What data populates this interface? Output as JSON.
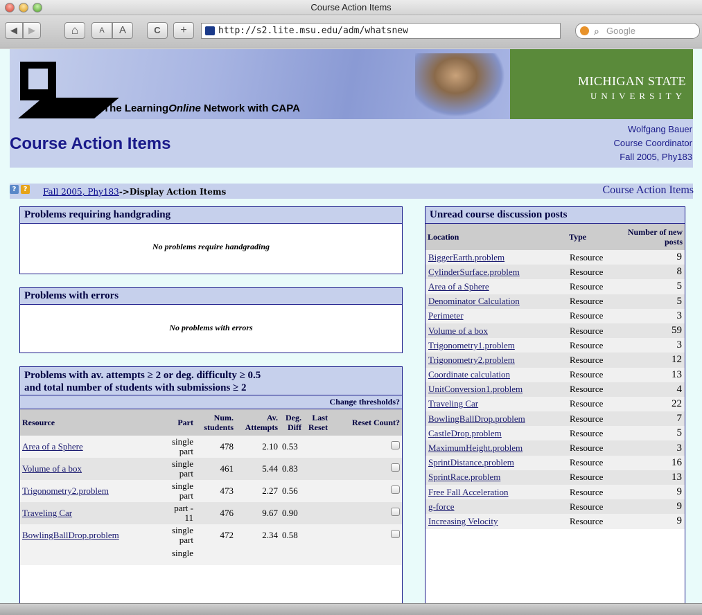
{
  "window": {
    "title": "Course Action Items"
  },
  "toolbar": {
    "back": "◀",
    "forward": "▶",
    "home": "⌂",
    "text_smaller": "A",
    "text_bigger": "A",
    "reload": "C",
    "add": "+",
    "url": "http://s2.lite.msu.edu/adm/whatsnew",
    "search_placeholder": "Google"
  },
  "banner": {
    "network_prefix": "The Learning",
    "network_italic": "Online",
    "network_suffix": " Network with CAPA",
    "msu_line1": "MICHIGAN STATE",
    "msu_line2": "UNIVERSITY"
  },
  "header": {
    "page_title": "Course Action Items",
    "user_name": "Wolfgang Bauer",
    "user_role": "Course Coordinator",
    "course": "Fall 2005, Phy183"
  },
  "nav": {
    "help_left": "?",
    "help_right": "?",
    "breadcrumb_link": "Fall 2005, Phy183",
    "breadcrumb_current": "->Display Action Items",
    "right_title": "Course Action Items"
  },
  "handgrading": {
    "title": "Problems requiring handgrading",
    "message": "No problems require handgrading"
  },
  "errors": {
    "title": "Problems with errors",
    "message": "No problems with errors"
  },
  "difficulty": {
    "title_line1": "Problems with av. attempts ≥ 2 or deg. difficulty ≥ 0.5",
    "title_line2": "and total number of students with submissions ≥ 2",
    "change_link": "Change thresholds?",
    "columns": [
      "Resource",
      "Part",
      "Num. students",
      "Av. Attempts",
      "Deg. Diff",
      "Last Reset",
      "Reset Count?"
    ],
    "rows": [
      {
        "resource": "Area of a Sphere",
        "part": "single part",
        "students": "478",
        "attempts": "2.10",
        "diff": "0.53",
        "last_reset": ""
      },
      {
        "resource": "Volume of a box",
        "part": "single part",
        "students": "461",
        "attempts": "5.44",
        "diff": "0.83",
        "last_reset": ""
      },
      {
        "resource": "Trigonometry2.problem",
        "part": "single part",
        "students": "473",
        "attempts": "2.27",
        "diff": "0.56",
        "last_reset": ""
      },
      {
        "resource": "Traveling Car",
        "part": "part - 11",
        "students": "476",
        "attempts": "9.67",
        "diff": "0.90",
        "last_reset": ""
      },
      {
        "resource": "BowlingBallDrop.problem",
        "part": "single part",
        "students": "472",
        "attempts": "2.34",
        "diff": "0.58",
        "last_reset": ""
      }
    ],
    "partial_row_part": "single"
  },
  "discussion": {
    "title": "Unread course discussion posts",
    "columns": [
      "Location",
      "Type",
      "Number of new posts"
    ],
    "rows": [
      {
        "location": "BiggerEarth.problem",
        "type": "Resource",
        "count": "9"
      },
      {
        "location": "CylinderSurface.problem",
        "type": "Resource",
        "count": "8"
      },
      {
        "location": "Area of a Sphere",
        "type": "Resource",
        "count": "5"
      },
      {
        "location": "Denominator Calculation",
        "type": "Resource",
        "count": "5"
      },
      {
        "location": "Perimeter",
        "type": "Resource",
        "count": "3"
      },
      {
        "location": "Volume of a box",
        "type": "Resource",
        "count": "59"
      },
      {
        "location": "Trigonometry1.problem",
        "type": "Resource",
        "count": "3"
      },
      {
        "location": "Trigonometry2.problem",
        "type": "Resource",
        "count": "12"
      },
      {
        "location": "Coordinate calculation",
        "type": "Resource",
        "count": "13"
      },
      {
        "location": "UnitConversion1.problem",
        "type": "Resource",
        "count": "4"
      },
      {
        "location": "Traveling Car",
        "type": "Resource",
        "count": "22"
      },
      {
        "location": "BowlingBallDrop.problem",
        "type": "Resource",
        "count": "7"
      },
      {
        "location": "CastleDrop.problem",
        "type": "Resource",
        "count": "5"
      },
      {
        "location": "MaximumHeight.problem",
        "type": "Resource",
        "count": "3"
      },
      {
        "location": "SprintDistance.problem",
        "type": "Resource",
        "count": "16"
      },
      {
        "location": "SprintRace.problem",
        "type": "Resource",
        "count": "13"
      },
      {
        "location": "Free Fall Acceleration",
        "type": "Resource",
        "count": "9"
      },
      {
        "location": "g-force",
        "type": "Resource",
        "count": "9"
      },
      {
        "location": "Increasing Velocity",
        "type": "Resource",
        "count": "9"
      }
    ]
  }
}
